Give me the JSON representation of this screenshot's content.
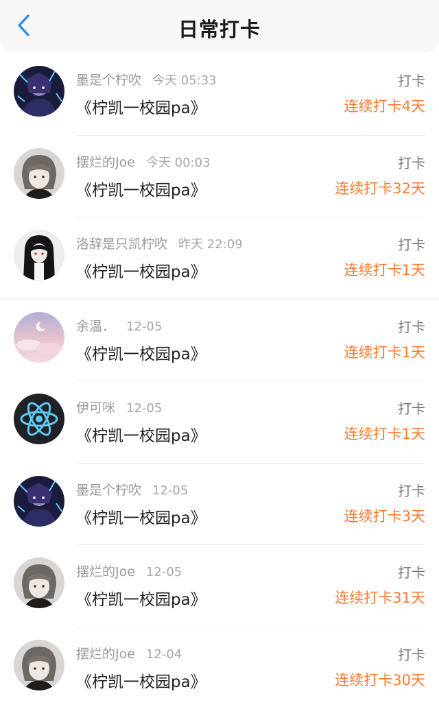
{
  "header": {
    "title": "日常打卡",
    "back_icon": "chevron-left-icon",
    "accent": "#2a8de8"
  },
  "colors": {
    "streak": "#ff7a30"
  },
  "rows": [
    {
      "user": "墨是个柠吹",
      "time": "今天 05:33",
      "title": "《柠凯一校园pa》",
      "action": "打卡",
      "streak": "连续打卡4天",
      "avatar": "anime-dark-blue"
    },
    {
      "user": "摆烂的Joe",
      "time": "今天 00:03",
      "title": "《柠凯一校园pa》",
      "action": "打卡",
      "streak": "连续打卡32天",
      "avatar": "anime-grey-hair"
    },
    {
      "user": "洛辞是只凯柠吹",
      "time": "昨天 22:09",
      "title": "《柠凯一校园pa》",
      "action": "打卡",
      "streak": "连续打卡1天",
      "avatar": "anime-black-hair"
    },
    {
      "user": "余温．",
      "time": "12-05",
      "title": "《柠凯一校园pa》",
      "action": "打卡",
      "streak": "连续打卡1天",
      "avatar": "pink-sky-moon"
    },
    {
      "user": "伊可咪",
      "time": "12-05",
      "title": "《柠凯一校园pa》",
      "action": "打卡",
      "streak": "连续打卡1天",
      "avatar": "react-atom-logo"
    },
    {
      "user": "墨是个柠吹",
      "time": "12-05",
      "title": "《柠凯一校园pa》",
      "action": "打卡",
      "streak": "连续打卡3天",
      "avatar": "anime-dark-blue"
    },
    {
      "user": "摆烂的Joe",
      "time": "12-05",
      "title": "《柠凯一校园pa》",
      "action": "打卡",
      "streak": "连续打卡31天",
      "avatar": "anime-grey-hair"
    },
    {
      "user": "摆烂的Joe",
      "time": "12-04",
      "title": "《柠凯一校园pa》",
      "action": "打卡",
      "streak": "连续打卡30天",
      "avatar": "anime-grey-hair"
    }
  ]
}
